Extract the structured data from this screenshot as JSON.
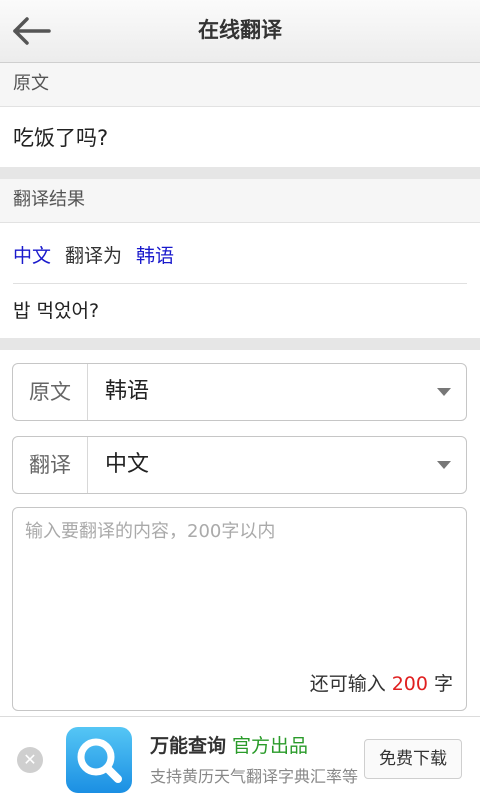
{
  "header": {
    "title": "在线翻译",
    "back_icon": "back-arrow-icon"
  },
  "source_section": {
    "heading": "原文",
    "text": "吃饭了吗?"
  },
  "result_section": {
    "heading": "翻译结果",
    "from_lang": "中文",
    "connector": "翻译为",
    "to_lang": "韩语",
    "text": "밥 먹었어?"
  },
  "source_select": {
    "label": "原文",
    "value": "韩语"
  },
  "target_select": {
    "label": "翻译",
    "value": "中文"
  },
  "input": {
    "placeholder": "输入要翻译的内容，200字以内",
    "value": "",
    "counter_prefix": "还可输入",
    "counter_value": "200",
    "counter_suffix": "字"
  },
  "ad": {
    "app_name": "万能查询",
    "badge": "官方出品",
    "subtitle": "支持黄历天气翻译字典汇率等",
    "download_label": "免费下载",
    "close_icon": "close-icon",
    "app_icon": "search-magnifier-app-icon"
  },
  "colors": {
    "link_blue": "#1a1acc",
    "counter_red": "#e02020",
    "badge_green": "#2a9b2a",
    "app_icon_blue": "#1b8fe3"
  }
}
